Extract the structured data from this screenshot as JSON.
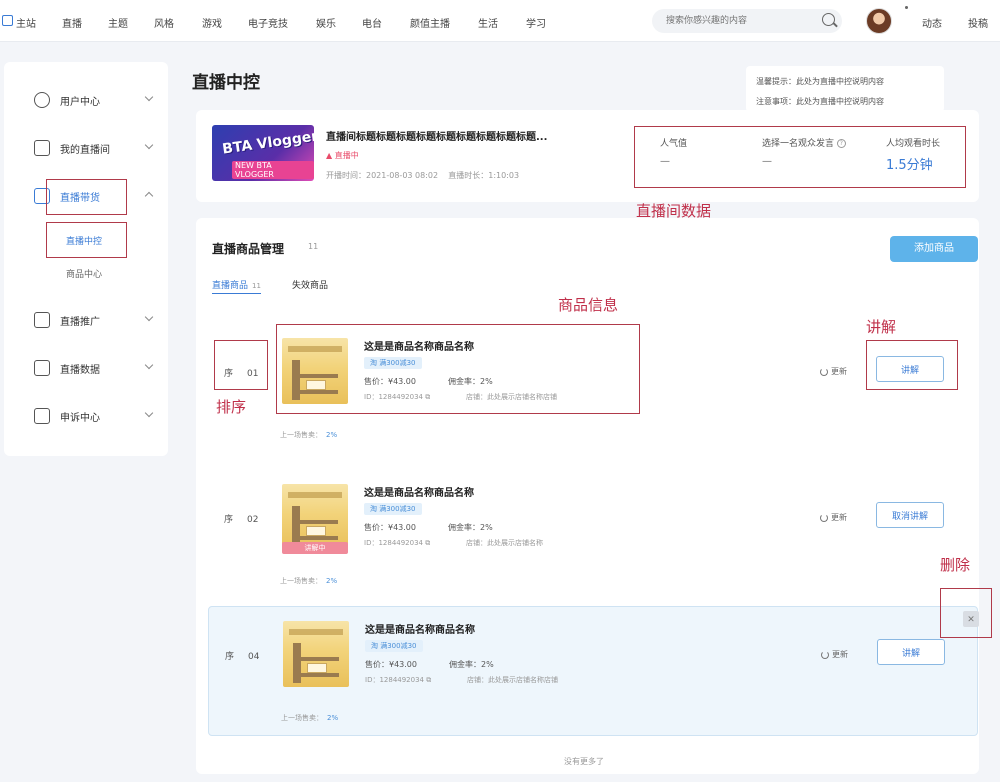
{
  "nav": {
    "items": [
      "主站",
      "直播",
      "主题",
      "风格",
      "游戏",
      "电子竞技",
      "娱乐",
      "电台",
      "颜值主播",
      "生活",
      "学习"
    ],
    "search_placeholder": "搜索你感兴趣的内容",
    "right": [
      "动态",
      "投稿"
    ]
  },
  "sidebar": {
    "items": [
      {
        "label": "用户中心",
        "icon": "user-icon"
      },
      {
        "label": "我的直播间",
        "icon": "tv-icon"
      },
      {
        "label": "直播带货",
        "icon": "cart-icon",
        "expanded": true
      },
      {
        "label": "直播推广",
        "icon": "promo-icon"
      },
      {
        "label": "直播数据",
        "icon": "chart-icon"
      },
      {
        "label": "申诉中心",
        "icon": "appeal-icon"
      }
    ],
    "sub_items": [
      "直播中控",
      "商品中心"
    ]
  },
  "page": {
    "title": "直播中控"
  },
  "notice": {
    "line1": "温馨提示：此处为直播中控说明内容",
    "line2": "注意事项：此处为直播中控说明内容"
  },
  "live": {
    "title": "直播间标题标题标题标题标题标题标题标题标题...",
    "cover_text": "BTA Vlogger",
    "cover_sub": "NEW BTA VLOGGER",
    "status": "直播中",
    "start_label": "开播时间：",
    "start_time": "2021-08-03 08:02",
    "duration_label": "直播时长：",
    "duration": "1:10:03",
    "stats": [
      {
        "label": "人气值",
        "value": "—"
      },
      {
        "label": "选择一名观众发言",
        "value": "—"
      },
      {
        "label": "人均观看时长",
        "value": "1.5分钟"
      }
    ]
  },
  "annotations": {
    "live_data": "直播间数据",
    "product_info": "商品信息",
    "explain": "讲解",
    "sort": "排序",
    "delete": "删除"
  },
  "products_panel": {
    "title": "直播商品管理",
    "count": "11",
    "add_button": "添加商品",
    "tabs": [
      {
        "label": "直播商品",
        "count": "11"
      },
      {
        "label": "失效商品",
        "count": ""
      }
    ],
    "no_more": "没有更多了",
    "items": [
      {
        "rank_label": "序",
        "rank": "01",
        "name": "这是是商品名称商品名称",
        "tag": "淘 满300减30",
        "price": "售价：¥43.00",
        "rate": "佣金率：2%",
        "id": "ID：1284492034",
        "shop": "店铺：此处展示店铺名称店铺",
        "prev": "上一场售卖：",
        "prev_value": "2%",
        "refresh": "更新",
        "button": "讲解",
        "explaining": ""
      },
      {
        "rank_label": "序",
        "rank": "02",
        "name": "这是是商品名称商品名称",
        "tag": "淘 满300减30",
        "price": "售价：¥43.00",
        "rate": "佣金率：2%",
        "id": "ID：1284492034",
        "shop": "店铺：此处展示店铺名称",
        "prev": "上一场售卖：",
        "prev_value": "2%",
        "refresh": "更新",
        "button": "取消讲解",
        "explaining": "讲解中"
      },
      {
        "rank_label": "序",
        "rank": "04",
        "name": "这是是商品名称商品名称",
        "tag": "淘 满300减30",
        "price": "售价：¥43.00",
        "rate": "佣金率：2%",
        "id": "ID：1284492034",
        "shop": "店铺：此处展示店铺名称店铺",
        "prev": "上一场售卖：",
        "prev_value": "2%",
        "refresh": "更新",
        "button": "讲解",
        "explaining": ""
      }
    ]
  },
  "colors": {
    "accent": "#3a7bd5",
    "annotation": "#b03a4a",
    "explaining": "#f08a9a",
    "add_button": "#5eb3ea"
  }
}
